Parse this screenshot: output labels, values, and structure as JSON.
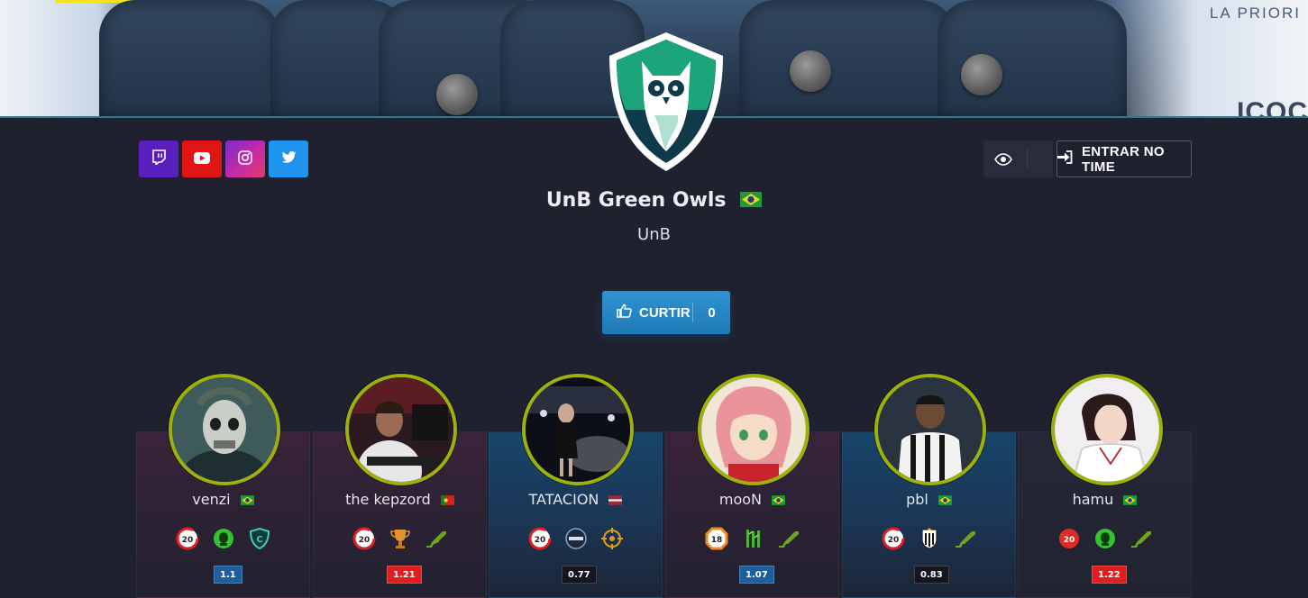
{
  "banner": {
    "sponsor_top": "LA PRIORI",
    "sponsor_bottom": "ICOC"
  },
  "team": {
    "name": "UnB Green Owls",
    "short": "UnB",
    "flag": "brazil-flag-icon"
  },
  "socials": [
    {
      "name": "twitch",
      "icon": "twitch-icon",
      "color": "#5a1fbf"
    },
    {
      "name": "youtube",
      "icon": "youtube-icon",
      "color": "#e01616"
    },
    {
      "name": "instagram",
      "icon": "instagram-icon",
      "color": "#c72aa5"
    },
    {
      "name": "twitter",
      "icon": "twitter-icon",
      "color": "#1f94ee"
    }
  ],
  "actions": {
    "watch_icon": "eye-icon",
    "join_label": "ENTRAR NO TIME",
    "like_label": "CURTIR",
    "like_count": "0"
  },
  "players": [
    {
      "name": "venzi",
      "flag": "brazil",
      "level": "20",
      "rating": "1.1",
      "card": "red",
      "rating_color": "blue"
    },
    {
      "name": "the kepzord",
      "flag": "portugal",
      "level": "20",
      "rating": "1.21",
      "card": "red",
      "rating_color": "red"
    },
    {
      "name": "TATACION",
      "flag": "latvia",
      "level": "20",
      "rating": "0.77",
      "card": "blue",
      "rating_color": "dark"
    },
    {
      "name": "mooN",
      "flag": "brazil",
      "level": "18",
      "rating": "1.07",
      "card": "red",
      "rating_color": "blue"
    },
    {
      "name": "pbl",
      "flag": "brazil",
      "level": "20",
      "rating": "0.83",
      "card": "blue",
      "rating_color": "dark"
    },
    {
      "name": "hamu",
      "flag": "brazil",
      "level": "20",
      "rating": "1.22",
      "card": "dark",
      "rating_color": "red"
    }
  ],
  "colors": {
    "background": "#20212f",
    "avatar_ring": "#9db10e",
    "like_button": "#1f7ab6",
    "owl_green": "#1ca57a",
    "owl_navy": "#0e3a4a"
  }
}
